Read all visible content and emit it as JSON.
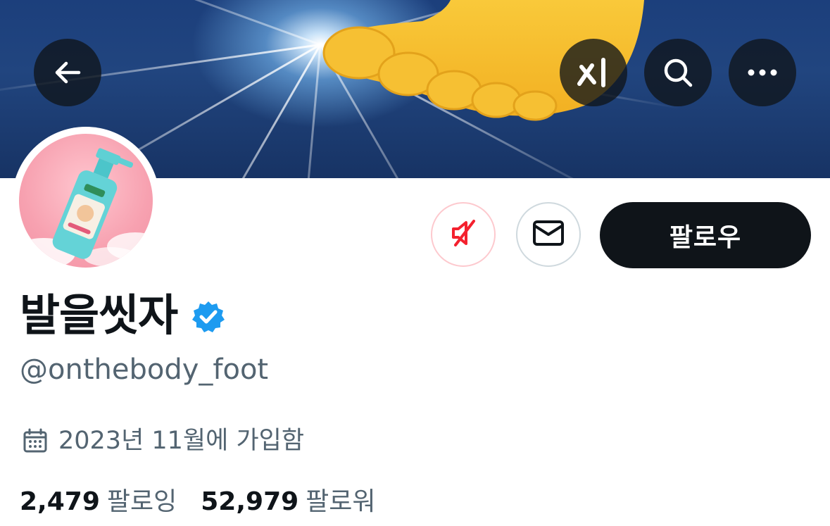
{
  "header": {
    "back_icon": "arrow-left-icon",
    "grok_icon": "grok-icon",
    "search_icon": "search-icon",
    "more_icon": "more-horizontal-icon"
  },
  "profile": {
    "display_name": "발을씻자",
    "verified": true,
    "handle": "@onthebody_foot",
    "joined": "2023년 11월에 가입함",
    "following_count": "2,479",
    "following_label": "팔로잉",
    "followers_count": "52,979",
    "followers_label": "팔로워"
  },
  "actions": {
    "mute_icon": "muted-speaker-icon",
    "message_icon": "envelope-icon",
    "follow_label": "팔로우"
  },
  "colors": {
    "accent_blue": "#1d9bf0",
    "text_primary": "#0f1419",
    "text_secondary": "#536471",
    "mute_red": "#f4212e"
  }
}
